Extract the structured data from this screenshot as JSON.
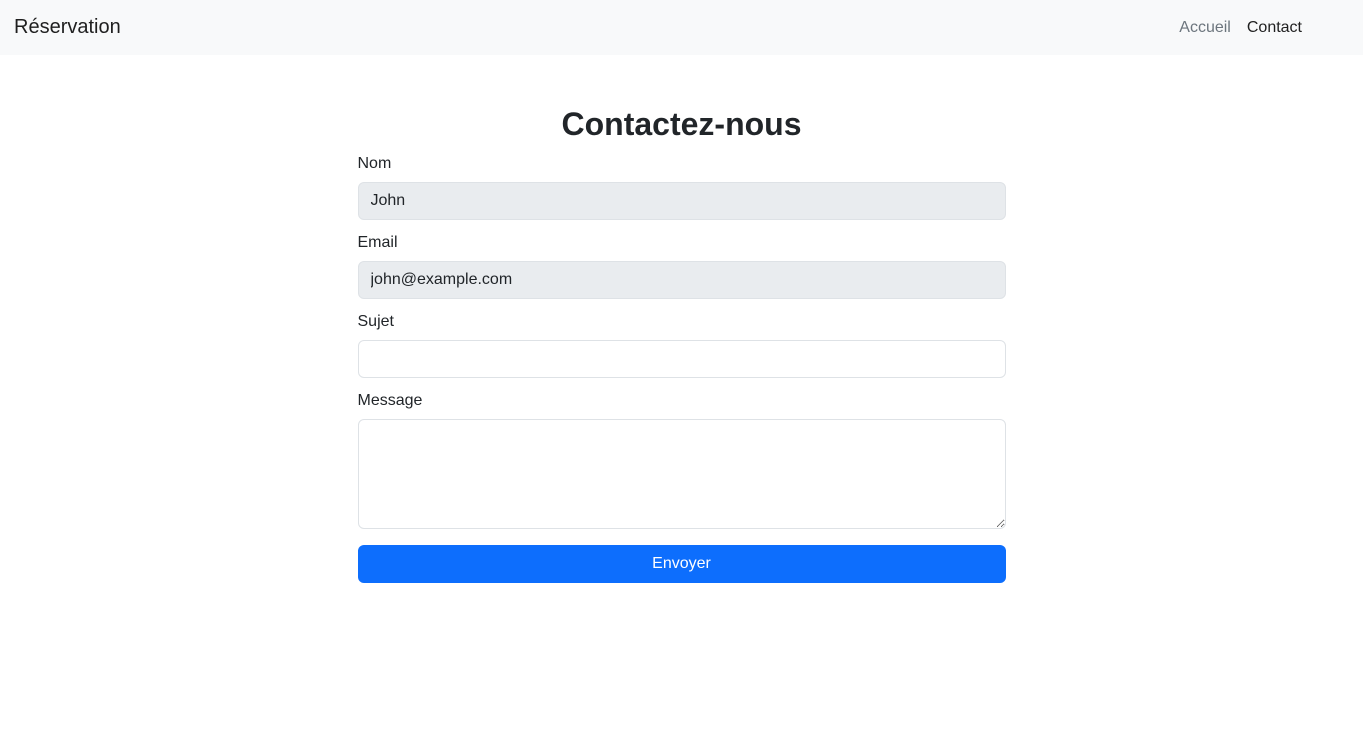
{
  "navbar": {
    "brand": "Réservation",
    "links": [
      {
        "label": "Accueil"
      },
      {
        "label": "Contact"
      }
    ]
  },
  "page": {
    "title": "Contactez-nous"
  },
  "form": {
    "name": {
      "label": "Nom",
      "value": "John"
    },
    "email": {
      "label": "Email",
      "value": "john@example.com"
    },
    "subject": {
      "label": "Sujet",
      "value": ""
    },
    "message": {
      "label": "Message",
      "value": ""
    },
    "submit_label": "Envoyer"
  },
  "colors": {
    "primary": "#0d6efd",
    "navbar_bg": "#f8f9fa",
    "readonly_bg": "#e9ecef"
  }
}
